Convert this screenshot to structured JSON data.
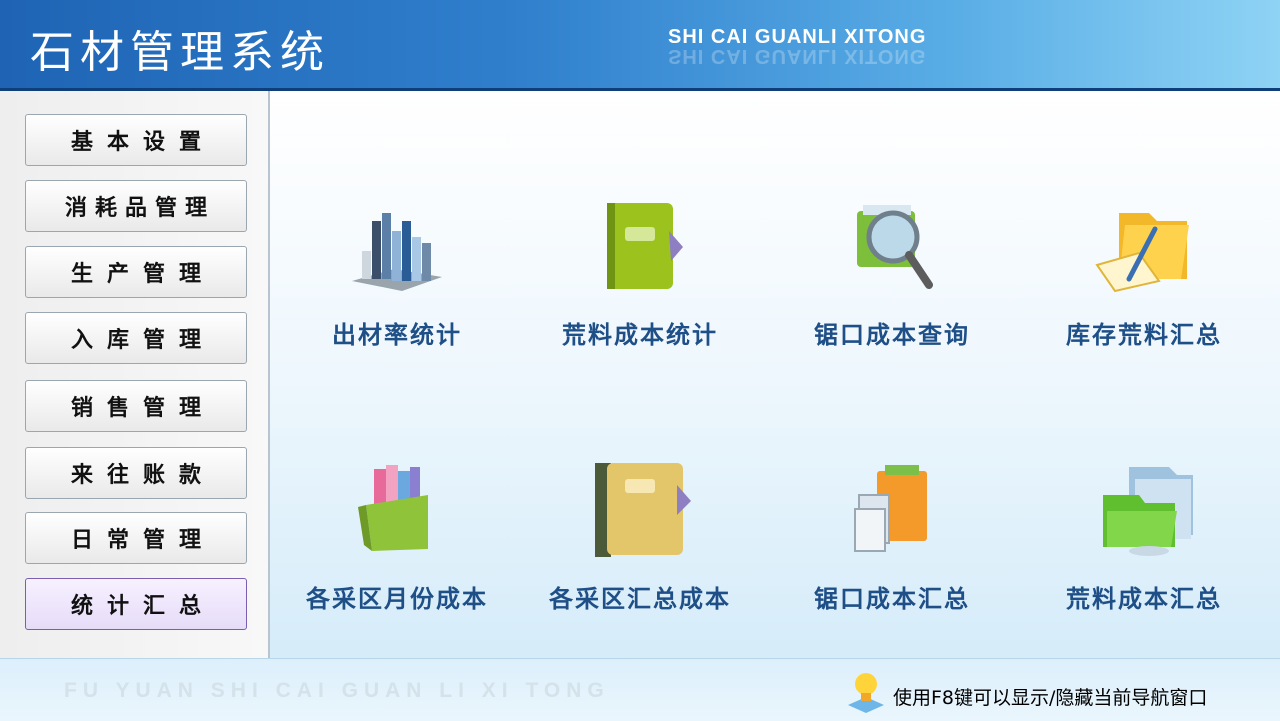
{
  "header": {
    "title": "石材管理系统",
    "subtitle": "SHI CAI GUANLI XITONG"
  },
  "sidebar": {
    "items": [
      {
        "label": "基本设置"
      },
      {
        "label": "消耗品管理"
      },
      {
        "label": "生产管理"
      },
      {
        "label": "入库管理"
      },
      {
        "label": "销售管理"
      },
      {
        "label": "来往账款"
      },
      {
        "label": "日常管理"
      },
      {
        "label": "统计汇总",
        "active": true
      }
    ]
  },
  "main": {
    "tiles": [
      {
        "label": "出材率统计",
        "icon": "bar-chart-icon"
      },
      {
        "label": "荒料成本统计",
        "icon": "green-book-icon"
      },
      {
        "label": "锯口成本查询",
        "icon": "magnifier-icon"
      },
      {
        "label": "库存荒料汇总",
        "icon": "folder-pen-icon"
      },
      {
        "label": "各采区月份成本",
        "icon": "binder-box-icon"
      },
      {
        "label": "各采区汇总成本",
        "icon": "yellow-book-icon"
      },
      {
        "label": "锯口成本汇总",
        "icon": "documents-icon"
      },
      {
        "label": "荒料成本汇总",
        "icon": "green-folder-icon"
      }
    ]
  },
  "footer": {
    "brand": "FU YUAN SHI CAI GUAN LI XI TONG",
    "tip": "使用F8键可以显示/隐藏当前导航窗口"
  },
  "colors": {
    "header_start": "#1f64b4",
    "header_end": "#8fd3f5",
    "tile_label": "#1f4f87",
    "active_nav": "#e6dcf8"
  }
}
